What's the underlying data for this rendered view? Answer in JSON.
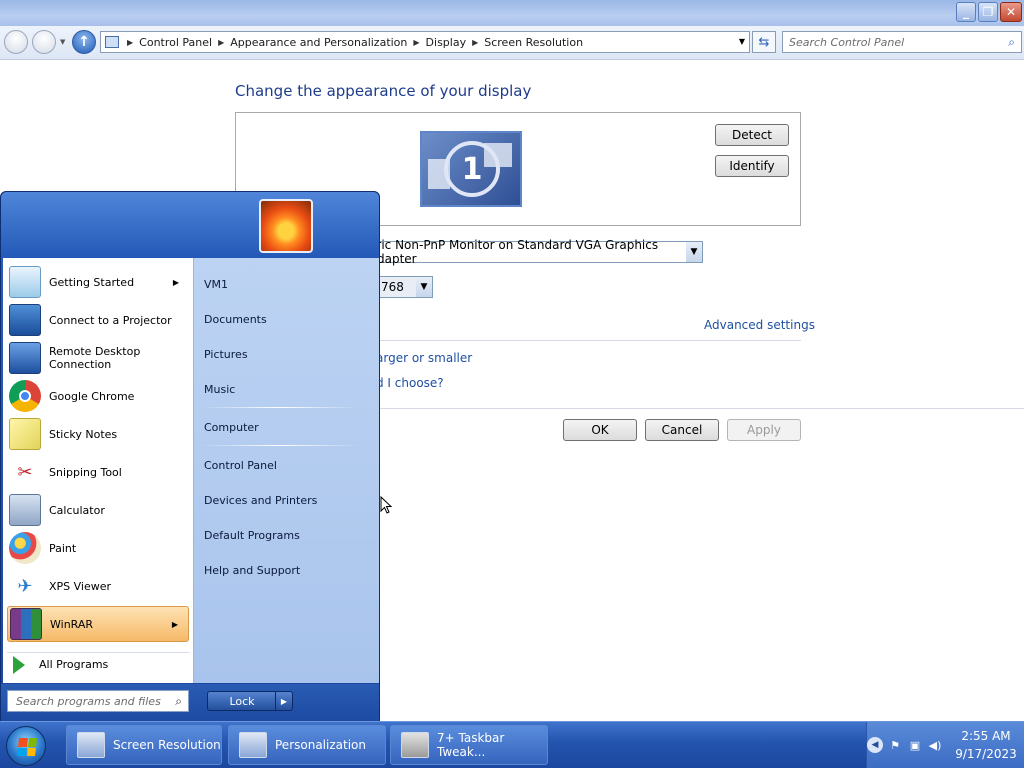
{
  "window": {
    "caption_buttons": {
      "minimize": "_",
      "maximize": "❐",
      "close": "✕"
    }
  },
  "navbar": {
    "breadcrumbs": [
      "Control Panel",
      "Appearance and Personalization",
      "Display",
      "Screen Resolution"
    ],
    "search_placeholder": "Search Control Panel"
  },
  "content": {
    "heading": "Change the appearance of your display",
    "monitor_number": "1",
    "detect_label": "Detect",
    "identify_label": "Identify",
    "display_value": "eric Non-PnP Monitor on Standard VGA Graphics Adapter",
    "resolution_value": "768",
    "advanced_link": "Advanced settings",
    "link_text_size": "arger or smaller",
    "link_choose": "d I choose?",
    "ok_label": "OK",
    "cancel_label": "Cancel",
    "apply_label": "Apply"
  },
  "start_menu": {
    "programs": [
      {
        "label": "Getting Started",
        "icon": "getting-started-icon",
        "submenu": true
      },
      {
        "label": "Connect to a Projector",
        "icon": "projector-icon",
        "submenu": false
      },
      {
        "label": "Remote Desktop Connection",
        "icon": "remote-desktop-icon",
        "submenu": false
      },
      {
        "label": "Google Chrome",
        "icon": "chrome-icon",
        "submenu": false
      },
      {
        "label": "Sticky Notes",
        "icon": "sticky-notes-icon",
        "submenu": false
      },
      {
        "label": "Snipping Tool",
        "icon": "snipping-tool-icon",
        "submenu": false
      },
      {
        "label": "Calculator",
        "icon": "calculator-icon",
        "submenu": false
      },
      {
        "label": "Paint",
        "icon": "paint-icon",
        "submenu": false
      },
      {
        "label": "XPS Viewer",
        "icon": "xps-viewer-icon",
        "submenu": false
      },
      {
        "label": "WinRAR",
        "icon": "winrar-icon",
        "submenu": true
      }
    ],
    "all_programs": "All Programs",
    "right_links": [
      "VM1",
      "Documents",
      "Pictures",
      "Music",
      "Computer",
      "Control Panel",
      "Devices and Printers",
      "Default Programs",
      "Help and Support"
    ],
    "search_placeholder": "Search programs and files",
    "lock_label": "Lock"
  },
  "taskbar": {
    "tasks": [
      "Screen Resolution",
      "Personalization",
      "7+ Taskbar Tweak..."
    ],
    "time": "2:55 AM",
    "date": "9/17/2023"
  },
  "colors": {
    "heading": "#1e3c8c",
    "link": "#1e50a2",
    "taskbar": "#2354ae",
    "highlight": "#f6b968"
  }
}
